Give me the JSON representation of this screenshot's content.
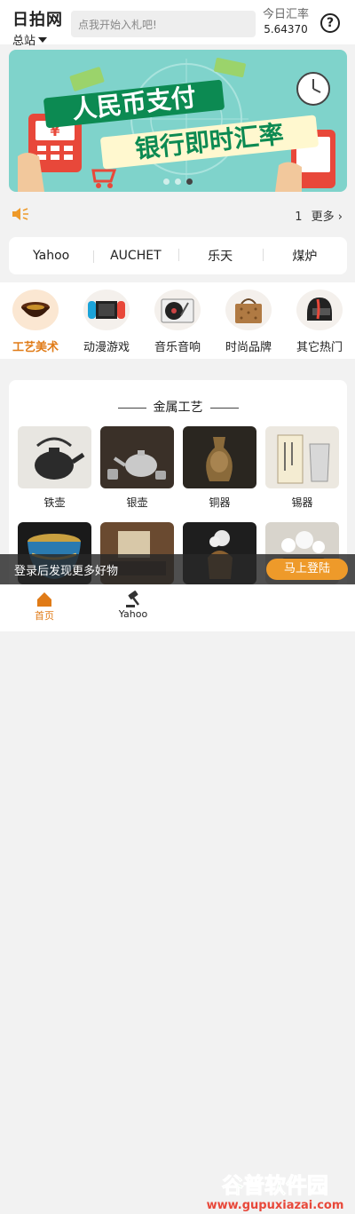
{
  "header": {
    "brand": "日拍网",
    "site": "总站",
    "search_placeholder": "点我开始入札吧!",
    "rate_label": "今日汇率",
    "rate_value": "5.64370",
    "help": "?"
  },
  "banner": {
    "line1": "人民币支付",
    "line2": "银行即时汇率",
    "currency_symbol": "¥"
  },
  "notice": {
    "count": "1",
    "more": "更多"
  },
  "platforms": [
    "Yahoo",
    "AUCHET",
    "乐天",
    "煤炉"
  ],
  "categories": [
    {
      "label": "工艺美术",
      "icon": "lacquer-bowl-icon"
    },
    {
      "label": "动漫游戏",
      "icon": "game-console-icon"
    },
    {
      "label": "音乐音响",
      "icon": "turntable-icon"
    },
    {
      "label": "时尚品牌",
      "icon": "handbag-icon"
    },
    {
      "label": "其它热门",
      "icon": "helmet-icon"
    }
  ],
  "section": {
    "title": "金属工艺",
    "items": [
      {
        "label": "铁壶",
        "icon": "iron-kettle-icon"
      },
      {
        "label": "银壶",
        "icon": "silver-teapot-icon"
      },
      {
        "label": "铜器",
        "icon": "bronze-vase-icon"
      },
      {
        "label": "锡器",
        "icon": "tin-cup-icon"
      },
      {
        "label": "",
        "icon": "cloisonne-pot-icon"
      },
      {
        "label": "",
        "icon": "incense-box-icon"
      },
      {
        "label": "",
        "icon": "flower-basket-icon"
      },
      {
        "label": "",
        "icon": "flower-arrangement-icon"
      }
    ]
  },
  "login": {
    "text": "登录后发现更多好物",
    "button": "马上登陆"
  },
  "tabs": [
    {
      "label": "首页",
      "icon": "home-icon"
    },
    {
      "label": "Yahoo",
      "icon": "gavel-icon"
    }
  ],
  "watermark": {
    "title": "谷普软件园",
    "url": "www.gupuxiazai.com"
  },
  "colors": {
    "accent": "#e07b17",
    "login_button": "#ee9a2a",
    "banner_bg": "#7fd3cb"
  }
}
